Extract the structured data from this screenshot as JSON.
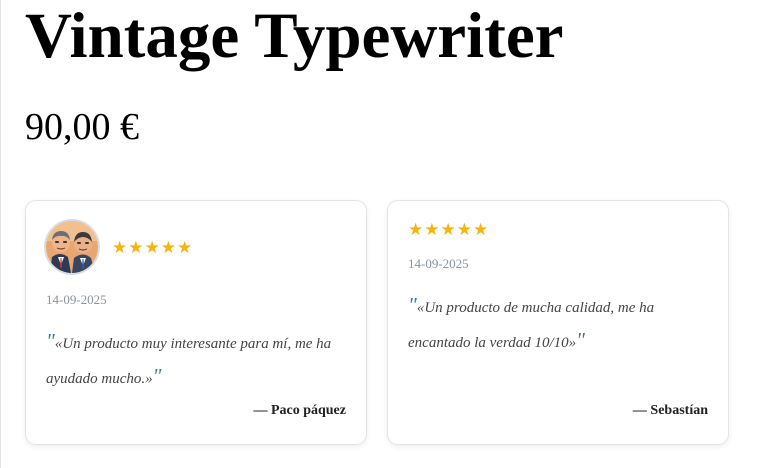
{
  "product": {
    "title": "Vintage Typewriter",
    "price": "90,00 €"
  },
  "colors": {
    "star": "#f5b50a",
    "quote_mark": "#2d7bb8",
    "date": "#8a94a0",
    "card_border": "#e2e4e8"
  },
  "reviews": [
    {
      "has_avatar": true,
      "avatar_icon": "cartoon-avatar-two-men-in-suits",
      "stars": "★★★★★",
      "rating": 5,
      "date": "14-09-2025",
      "open_quote": "\"",
      "text": "«Un producto muy interesante para mí, me ha ayudado mucho.»",
      "close_quote": "\"",
      "author": "— Paco páquez"
    },
    {
      "has_avatar": false,
      "stars": "★★★★★",
      "rating": 5,
      "date": "14-09-2025",
      "open_quote": "\"",
      "text": "«Un producto de mucha calidad, me ha encantado la verdad 10/10»",
      "close_quote": "\"",
      "author": "— Sebastían"
    }
  ]
}
